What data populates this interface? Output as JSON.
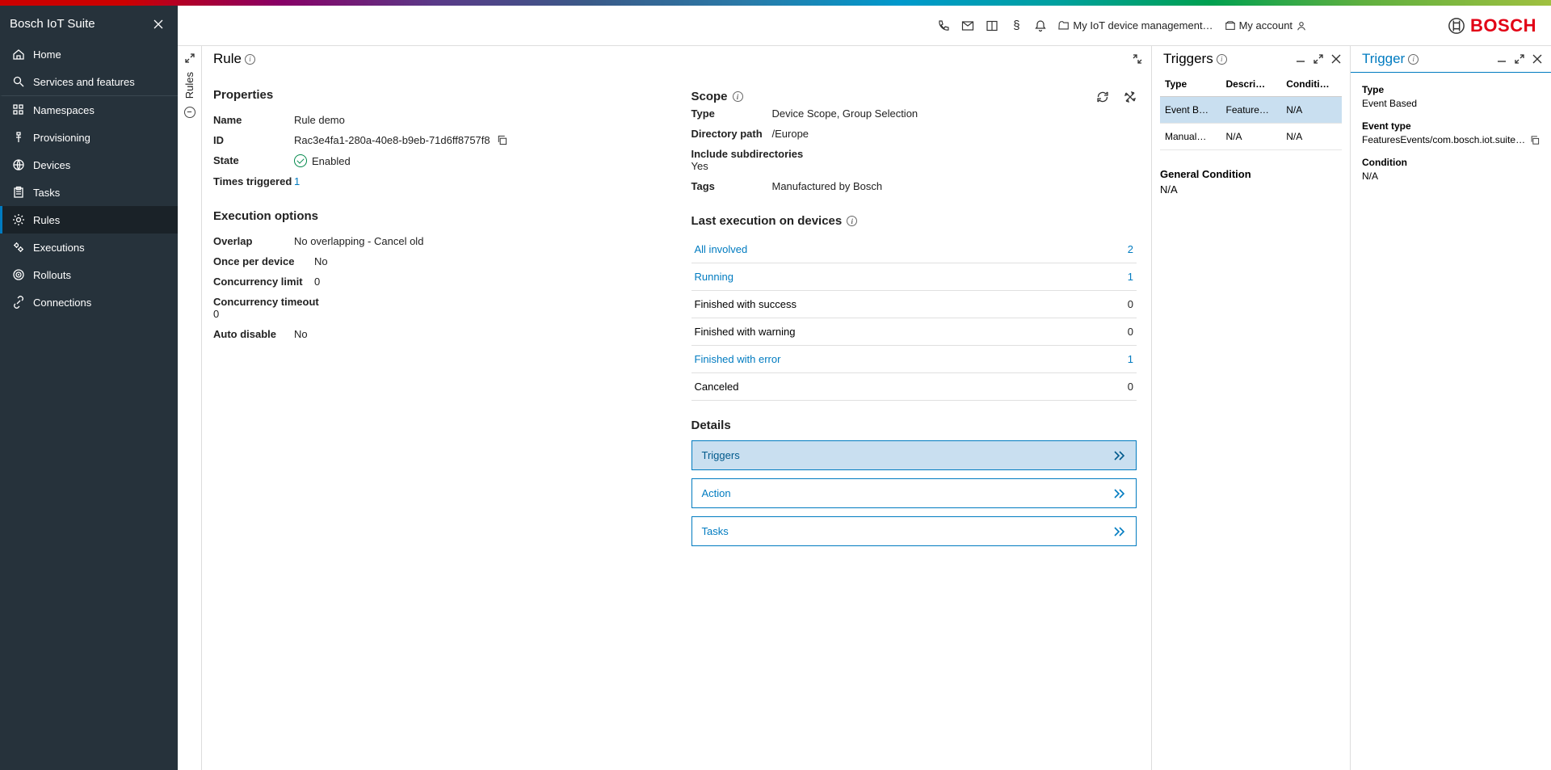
{
  "sidebar": {
    "title": "Bosch IoT Suite",
    "items": [
      {
        "label": "Home",
        "icon": "home"
      },
      {
        "label": "Services and features",
        "icon": "search"
      },
      {
        "label": "Namespaces",
        "icon": "grid"
      },
      {
        "label": "Provisioning",
        "icon": "usb"
      },
      {
        "label": "Devices",
        "icon": "globe"
      },
      {
        "label": "Tasks",
        "icon": "clipboard"
      },
      {
        "label": "Rules",
        "icon": "gear"
      },
      {
        "label": "Executions",
        "icon": "gears"
      },
      {
        "label": "Rollouts",
        "icon": "target"
      },
      {
        "label": "Connections",
        "icon": "link"
      }
    ]
  },
  "topbar": {
    "project": "My IoT device management…",
    "account": "My account"
  },
  "brand": "BOSCH",
  "vtab": {
    "label": "Rules"
  },
  "rulePanel": {
    "title": "Rule",
    "properties": {
      "heading": "Properties",
      "name_l": "Name",
      "name_v": "Rule demo",
      "id_l": "ID",
      "id_v": "Rac3e4fa1-280a-40e8-b9eb-71d6ff8757f8",
      "state_l": "State",
      "state_v": "Enabled",
      "times_l": "Times triggered",
      "times_v": "1"
    },
    "exec_opts": {
      "heading": "Execution options",
      "overlap_l": "Overlap",
      "overlap_v": "No overlapping - Cancel old",
      "once_l": "Once per device",
      "once_v": "No",
      "climit_l": "Concurrency limit",
      "climit_v": "0",
      "ctimeout_l": "Concurrency timeout",
      "ctimeout_v": "0",
      "autodis_l": "Auto disable",
      "autodis_v": "No"
    },
    "scope": {
      "heading": "Scope",
      "type_l": "Type",
      "type_v": "Device Scope, Group Selection",
      "dir_l": "Directory path",
      "dir_v": "/Europe",
      "inc_l": "Include subdirectories",
      "inc_v": "Yes",
      "tags_l": "Tags",
      "tags_v": "Manufactured by Bosch"
    },
    "last_exec": {
      "heading": "Last execution on devices",
      "rows": [
        {
          "label": "All involved",
          "count": "2",
          "link": true
        },
        {
          "label": "Running",
          "count": "1",
          "link": true
        },
        {
          "label": "Finished with success",
          "count": "0",
          "link": false
        },
        {
          "label": "Finished with warning",
          "count": "0",
          "link": false
        },
        {
          "label": "Finished with error",
          "count": "1",
          "link": true
        },
        {
          "label": "Canceled",
          "count": "0",
          "link": false
        }
      ]
    },
    "details": {
      "heading": "Details",
      "buttons": [
        "Triggers",
        "Action",
        "Tasks"
      ]
    }
  },
  "triggersPanel": {
    "title": "Triggers",
    "cols": [
      "Type",
      "Descri…",
      "Conditi…"
    ],
    "rows": [
      {
        "type": "Event B…",
        "desc": "Feature…",
        "cond": "N/A"
      },
      {
        "type": "Manual…",
        "desc": "N/A",
        "cond": "N/A"
      }
    ],
    "gc_l": "General Condition",
    "gc_v": "N/A"
  },
  "triggerPanel": {
    "title": "Trigger",
    "type_l": "Type",
    "type_v": "Event Based",
    "etype_l": "Event type",
    "etype_v": "FeaturesEvents/com.bosch.iot.suite…",
    "cond_l": "Condition",
    "cond_v": "N/A"
  }
}
